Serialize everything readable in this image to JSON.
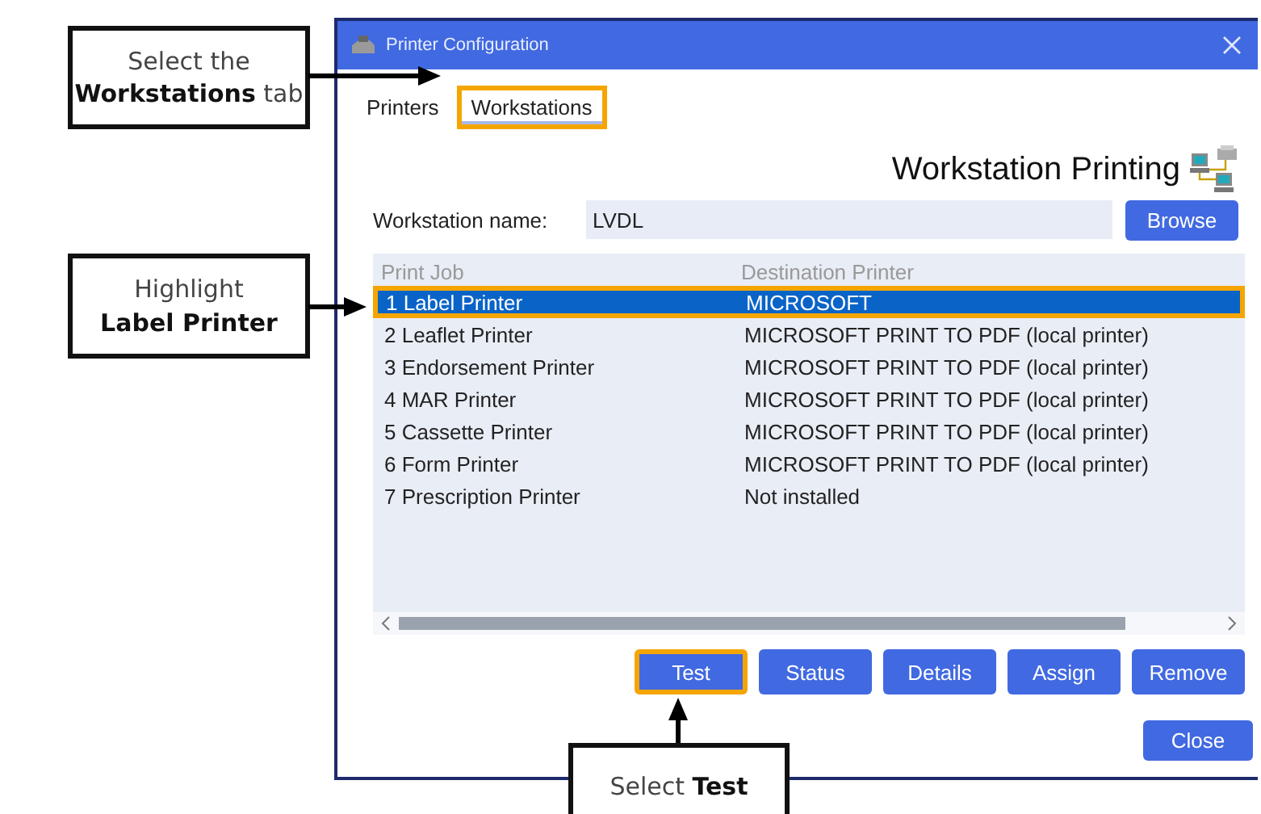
{
  "window": {
    "title": "Printer Configuration"
  },
  "tabs": [
    {
      "label": "Printers",
      "selected": false,
      "highlighted": false
    },
    {
      "label": "Workstations",
      "selected": true,
      "highlighted": true
    }
  ],
  "heading": "Workstation Printing",
  "workstation": {
    "label": "Workstation name:",
    "value": "LVDL",
    "browse": "Browse"
  },
  "table": {
    "columns": [
      "Print Job",
      "Destination Printer"
    ],
    "rows": [
      {
        "job": "1 Label Printer",
        "destination": "MICROSOFT",
        "selected": true,
        "highlighted": true
      },
      {
        "job": "2 Leaflet Printer",
        "destination": "MICROSOFT PRINT TO PDF (local printer)",
        "selected": false,
        "highlighted": false
      },
      {
        "job": "3 Endorsement Printer",
        "destination": "MICROSOFT PRINT TO PDF (local printer)",
        "selected": false,
        "highlighted": false
      },
      {
        "job": "4 MAR Printer",
        "destination": "MICROSOFT PRINT TO PDF (local printer)",
        "selected": false,
        "highlighted": false
      },
      {
        "job": "5 Cassette Printer",
        "destination": "MICROSOFT PRINT TO PDF (local printer)",
        "selected": false,
        "highlighted": false
      },
      {
        "job": "6 Form Printer",
        "destination": "MICROSOFT PRINT TO PDF (local printer)",
        "selected": false,
        "highlighted": false
      },
      {
        "job": "7 Prescription Printer",
        "destination": "Not installed",
        "selected": false,
        "highlighted": false
      }
    ]
  },
  "buttons": [
    {
      "label": "Test",
      "highlighted": true
    },
    {
      "label": "Status",
      "highlighted": false
    },
    {
      "label": "Details",
      "highlighted": false
    },
    {
      "label": "Assign",
      "highlighted": false
    },
    {
      "label": "Remove",
      "highlighted": false
    }
  ],
  "close": "Close",
  "callouts": [
    {
      "lines": [
        "Select the",
        "**Workstations** tab"
      ]
    },
    {
      "lines": [
        "Highlight",
        "**Label Printer**"
      ]
    },
    {
      "lines": [
        "Select **Test**"
      ]
    }
  ]
}
